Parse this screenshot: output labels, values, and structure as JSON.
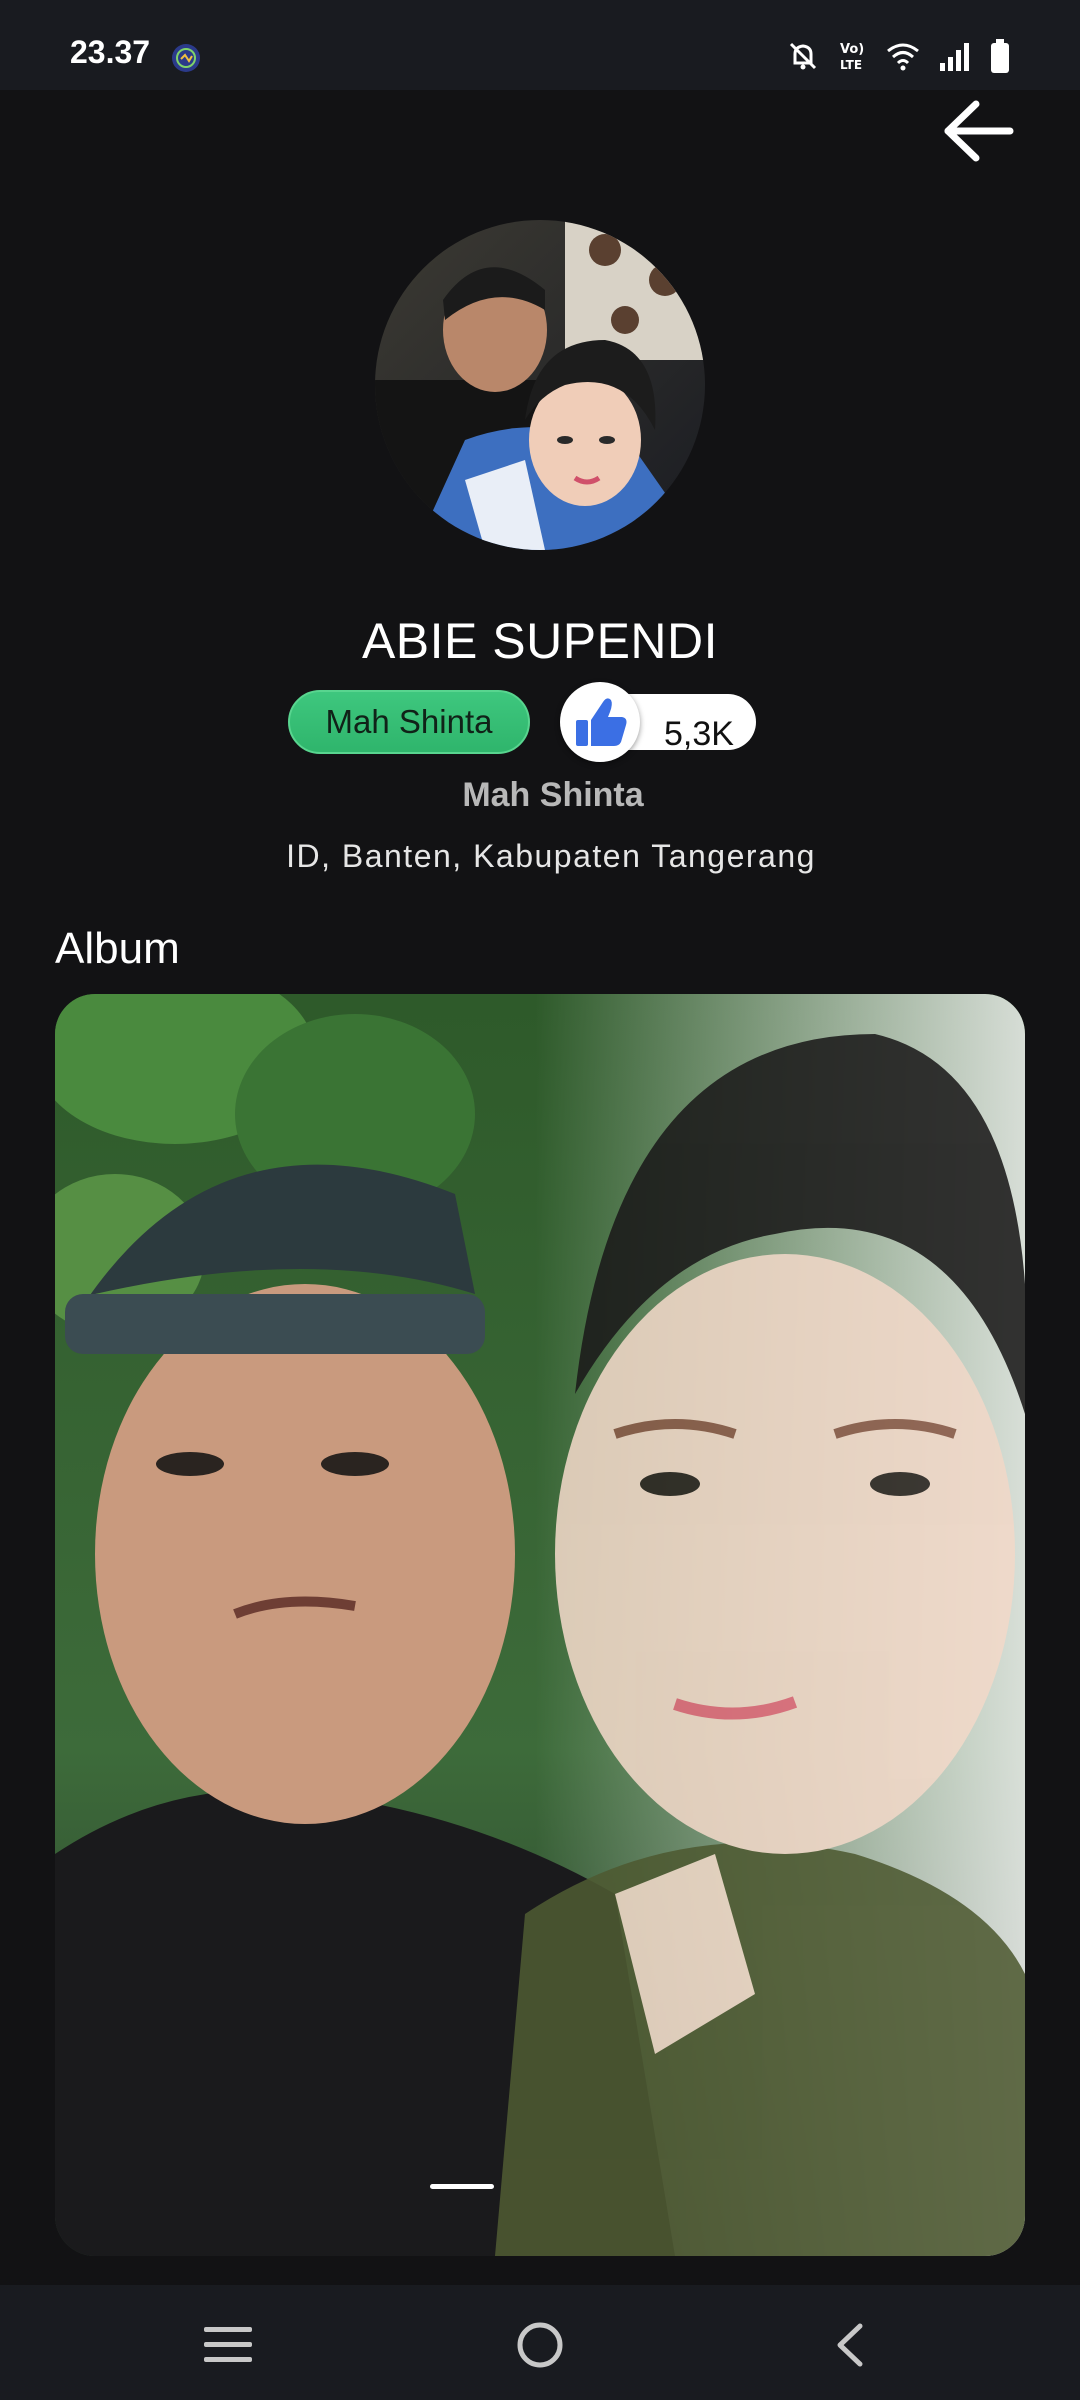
{
  "status_bar": {
    "time": "23.37",
    "app_icon": "app-notification-icon",
    "icons": [
      "mute-icon",
      "volte-icon",
      "wifi-icon",
      "signal-icon",
      "battery-icon"
    ]
  },
  "header": {
    "back_icon": "arrow-left-icon"
  },
  "profile": {
    "avatar_description": "profile-avatar",
    "name": "ABIE SUPENDI",
    "tag": "Mah Shinta",
    "like_icon": "thumbs-up-icon",
    "likes": "5,3K",
    "subtitle": "Mah Shinta",
    "location": "ID, Banten, Kabupaten Tangerang"
  },
  "album": {
    "title": "Album",
    "page_indicator": {
      "current": 1
    }
  },
  "nav_bar": {
    "items": [
      "recent-apps-icon",
      "home-icon",
      "back-icon"
    ]
  },
  "colors": {
    "background": "#121214",
    "tag_green": "#34bd73",
    "like_blue": "#3b6fe4"
  }
}
